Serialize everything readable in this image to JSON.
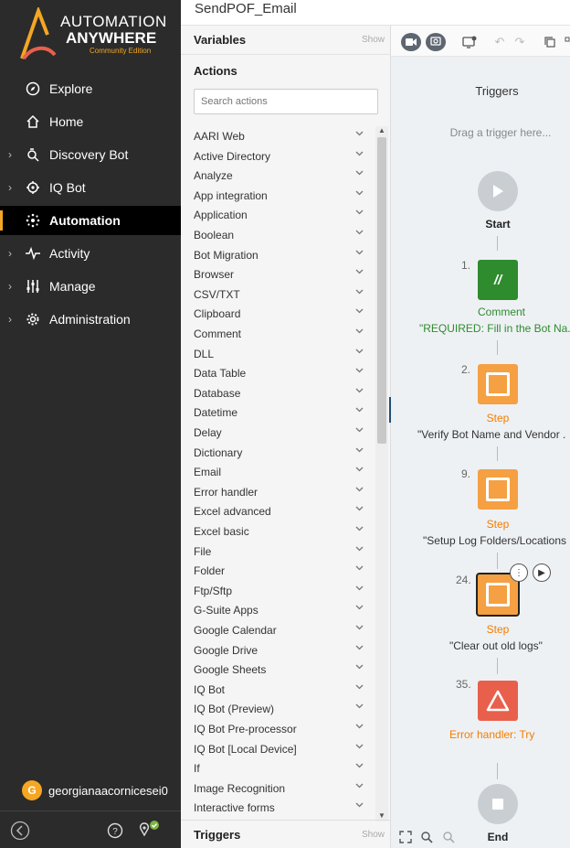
{
  "brand": {
    "line1": "AUTOMATION",
    "line2": "ANYWHERE",
    "edition": "Community Edition"
  },
  "nav": [
    {
      "label": "Explore",
      "icon": "compass-icon",
      "expandable": false,
      "active": false
    },
    {
      "label": "Home",
      "icon": "home-icon",
      "expandable": false,
      "active": false
    },
    {
      "label": "Discovery Bot",
      "icon": "discovery-bot-icon",
      "expandable": true,
      "active": false
    },
    {
      "label": "IQ Bot",
      "icon": "iq-bot-icon",
      "expandable": true,
      "active": false
    },
    {
      "label": "Automation",
      "icon": "automation-icon",
      "expandable": false,
      "active": true
    },
    {
      "label": "Activity",
      "icon": "activity-icon",
      "expandable": true,
      "active": false
    },
    {
      "label": "Manage",
      "icon": "manage-icon",
      "expandable": true,
      "active": false
    },
    {
      "label": "Administration",
      "icon": "gear-icon",
      "expandable": true,
      "active": false
    }
  ],
  "user": {
    "initial": "G",
    "name": "georgianaacornicesei0"
  },
  "header": {
    "title": "SendPOF_Email"
  },
  "panel": {
    "variables_title": "Variables",
    "show_label": "Show",
    "actions_title": "Actions",
    "search_placeholder": "Search actions",
    "triggers_title": "Triggers",
    "actions": [
      "AARI Web",
      "Active Directory",
      "Analyze",
      "App integration",
      "Application",
      "Boolean",
      "Bot Migration",
      "Browser",
      "CSV/TXT",
      "Clipboard",
      "Comment",
      "DLL",
      "Data Table",
      "Database",
      "Datetime",
      "Delay",
      "Dictionary",
      "Email",
      "Error handler",
      "Excel advanced",
      "Excel basic",
      "File",
      "Folder",
      "Ftp/Sftp",
      "G-Suite Apps",
      "Google Calendar",
      "Google Drive",
      "Google Sheets",
      "IQ Bot",
      "IQ Bot (Preview)",
      "IQ Bot Pre-processor",
      "IQ Bot [Local Device]",
      "If",
      "Image Recognition",
      "Interactive forms"
    ]
  },
  "canvas": {
    "triggers_label": "Triggers",
    "drag_hint": "Drag a trigger here...",
    "start_label": "Start",
    "end_label": "End",
    "nodes": [
      {
        "num": "1.",
        "type": "Comment",
        "desc": "\"REQUIRED: Fill in the Bot Na..."
      },
      {
        "num": "2.",
        "type": "Step",
        "desc": "\"Verify Bot Name and Vendor ."
      },
      {
        "num": "9.",
        "type": "Step",
        "desc": "\"Setup Log Folders/Locations"
      },
      {
        "num": "24.",
        "type": "Step",
        "desc": "\"Clear out old logs\""
      },
      {
        "num": "35.",
        "type": "Error handler: Try",
        "desc": ""
      }
    ]
  },
  "colors": {
    "accent": "#f5a623",
    "step": "#f5a042",
    "comment": "#2e8b2e",
    "error": "#e8604c",
    "sidebar": "#2b2b2b"
  }
}
